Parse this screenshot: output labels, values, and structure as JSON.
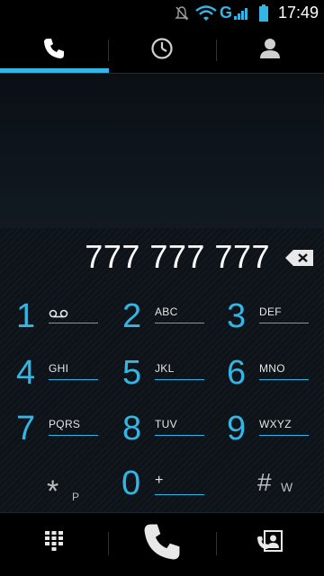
{
  "status_bar": {
    "time": "17:49",
    "network_label": "G",
    "icons": [
      "mute-icon",
      "wifi-icon",
      "signal-icon",
      "battery-icon"
    ]
  },
  "tabs": [
    {
      "name": "dialpad",
      "icon": "phone-icon",
      "selected": true
    },
    {
      "name": "call-log",
      "icon": "clock-icon",
      "selected": false
    },
    {
      "name": "contacts",
      "icon": "person-icon",
      "selected": false
    }
  ],
  "dialer": {
    "entered_number": "777 777 777"
  },
  "keys": [
    {
      "digit": "1",
      "letters": ""
    },
    {
      "digit": "2",
      "letters": "ABC"
    },
    {
      "digit": "3",
      "letters": "DEF"
    },
    {
      "digit": "4",
      "letters": "GHI"
    },
    {
      "digit": "5",
      "letters": "JKL"
    },
    {
      "digit": "6",
      "letters": "MNO"
    },
    {
      "digit": "7",
      "letters": "PQRS"
    },
    {
      "digit": "8",
      "letters": "TUV"
    },
    {
      "digit": "9",
      "letters": "WXYZ"
    },
    {
      "digit": "*",
      "letters": "P"
    },
    {
      "digit": "0",
      "letters": "+"
    },
    {
      "digit": "#",
      "letters": "W"
    }
  ],
  "colors": {
    "accent": "#33b5e5",
    "background": "#000000",
    "dialpad_background": "#0d1318"
  },
  "bottom_bar": {
    "icons": [
      "dialpad-toggle-icon",
      "call-icon",
      "add-contact-icon"
    ]
  }
}
